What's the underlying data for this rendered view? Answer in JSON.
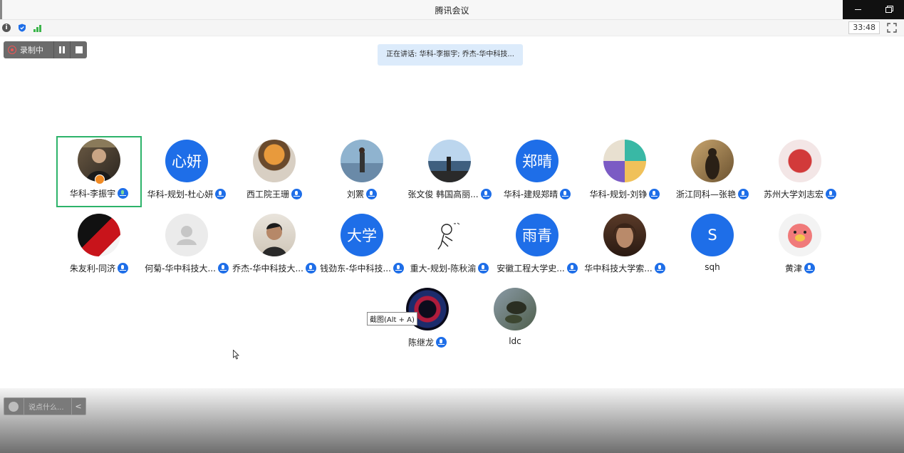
{
  "window": {
    "title": "腾讯会议"
  },
  "statusbar": {
    "timer": "33:48",
    "icons": [
      "info-icon",
      "shield-icon",
      "signal-icon",
      "fullscreen-icon"
    ]
  },
  "recording": {
    "label": "录制中"
  },
  "speaking": {
    "text": "正在讲话: 华科-李振宇; 乔杰-华中科技..."
  },
  "participants": [
    {
      "name": "华科-李振宇",
      "avatar_text": "",
      "mic": "speaking",
      "host": true
    },
    {
      "name": "华科-规划-杜心妍",
      "avatar_text": "心妍",
      "mic": "on"
    },
    {
      "name": "西工院王珊",
      "avatar_text": "",
      "mic": "on"
    },
    {
      "name": "刘罴",
      "avatar_text": "",
      "mic": "on"
    },
    {
      "name": "张文俊 韩国高丽...",
      "avatar_text": "",
      "mic": "on"
    },
    {
      "name": "华科-建规郑晴",
      "avatar_text": "郑晴",
      "mic": "on"
    },
    {
      "name": "华科-规划-刘铮",
      "avatar_text": "",
      "mic": "on"
    },
    {
      "name": "浙江同科—张艳",
      "avatar_text": "",
      "mic": "on"
    },
    {
      "name": "苏州大学刘志宏",
      "avatar_text": "",
      "mic": "on"
    },
    {
      "name": "朱友利-同济",
      "avatar_text": "",
      "mic": "on"
    },
    {
      "name": "何菊-华中科技大...",
      "avatar_text": "",
      "mic": "on"
    },
    {
      "name": "乔杰-华中科技大...",
      "avatar_text": "",
      "mic": "on"
    },
    {
      "name": "钱劲东-华中科技...",
      "avatar_text": "大学",
      "mic": "on"
    },
    {
      "name": "重大-规划-陈秋渝",
      "avatar_text": "",
      "mic": "on"
    },
    {
      "name": "安徽工程大学史...",
      "avatar_text": "雨青",
      "mic": "on"
    },
    {
      "name": "华中科技大学索...",
      "avatar_text": "",
      "mic": "on"
    },
    {
      "name": "sqh",
      "avatar_text": "S",
      "mic": "none"
    },
    {
      "name": "黄津",
      "avatar_text": "",
      "mic": "on"
    },
    {
      "name": "陈继龙",
      "avatar_text": "",
      "mic": "on"
    },
    {
      "name": "ldc",
      "avatar_text": "",
      "mic": "none"
    }
  ],
  "tooltip": {
    "text": "截图(Alt + A)"
  },
  "chat": {
    "placeholder": "说点什么..."
  },
  "colors": {
    "accent": "#1e6ee8",
    "active_border": "#2db36a",
    "speaking_bg": "#dcebfb"
  }
}
